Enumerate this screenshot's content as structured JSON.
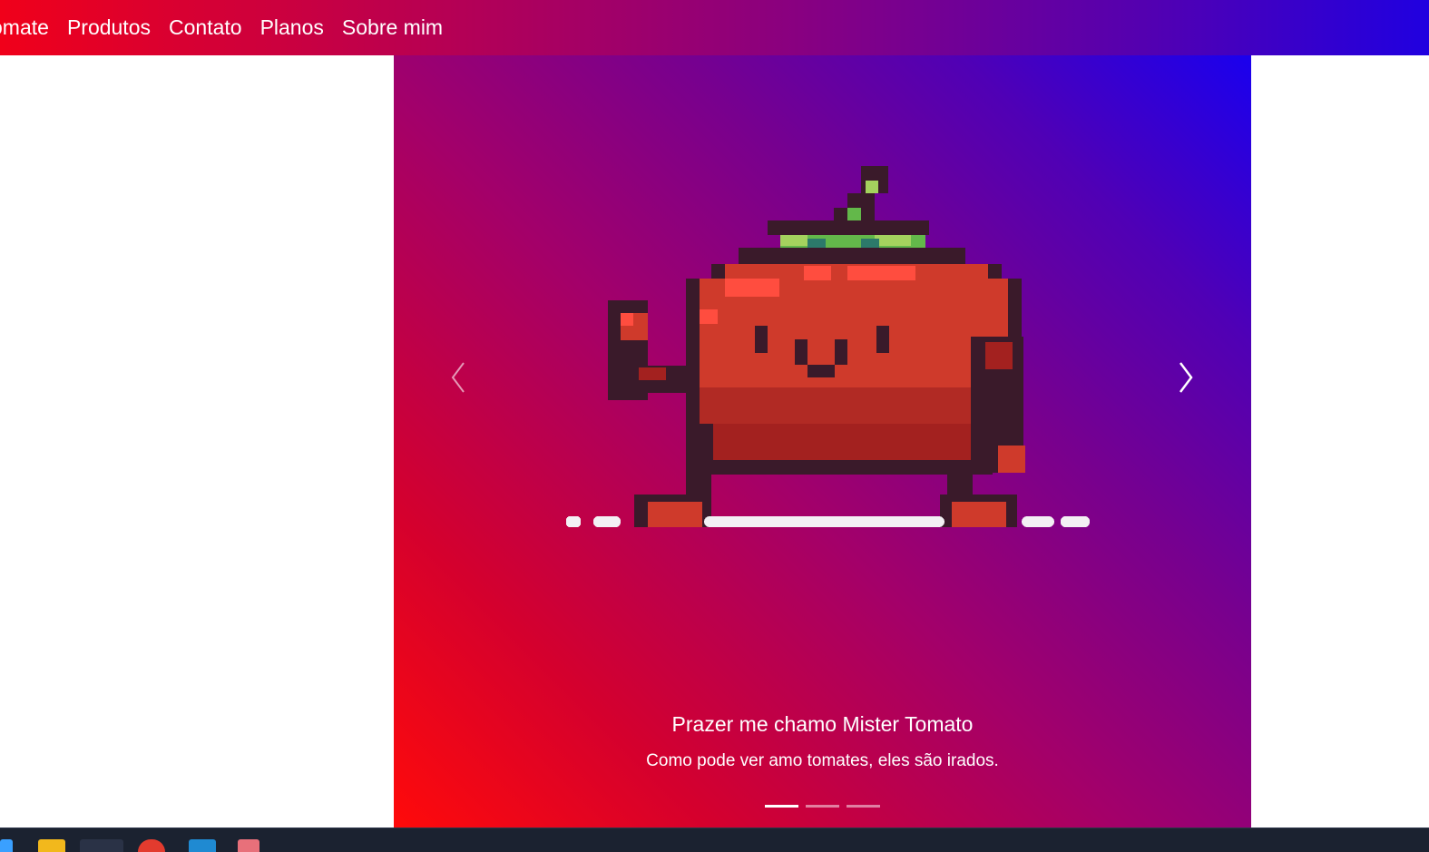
{
  "nav": {
    "links": [
      "omate",
      "Produtos",
      "Contato",
      "Planos",
      "Sobre mim"
    ]
  },
  "carousel": {
    "slide_title": "Prazer me chamo Mister Tomato",
    "slide_text": "Como pode ver amo tomates, eles são irados.",
    "indicator_count": 3,
    "active_indicator": 1,
    "image": "pixel-art-tomato-character"
  },
  "icons": {
    "prev": "chevron-left-icon",
    "next": "chevron-right-icon"
  },
  "taskbar": {
    "apps": [
      "start-icon",
      "file-explorer-icon",
      "browser-icon",
      "chrome-icon",
      "vscode-icon",
      "paint-icon"
    ]
  },
  "colors": {
    "gradient_red": "#ff0000",
    "gradient_purple": "#8a007f",
    "gradient_blue": "#1a00ee",
    "tomato_red": "#cf3a2b",
    "outline": "#3a1a2a",
    "leaf_green": "#63b84a",
    "taskbar_bg": "#1b2230"
  }
}
